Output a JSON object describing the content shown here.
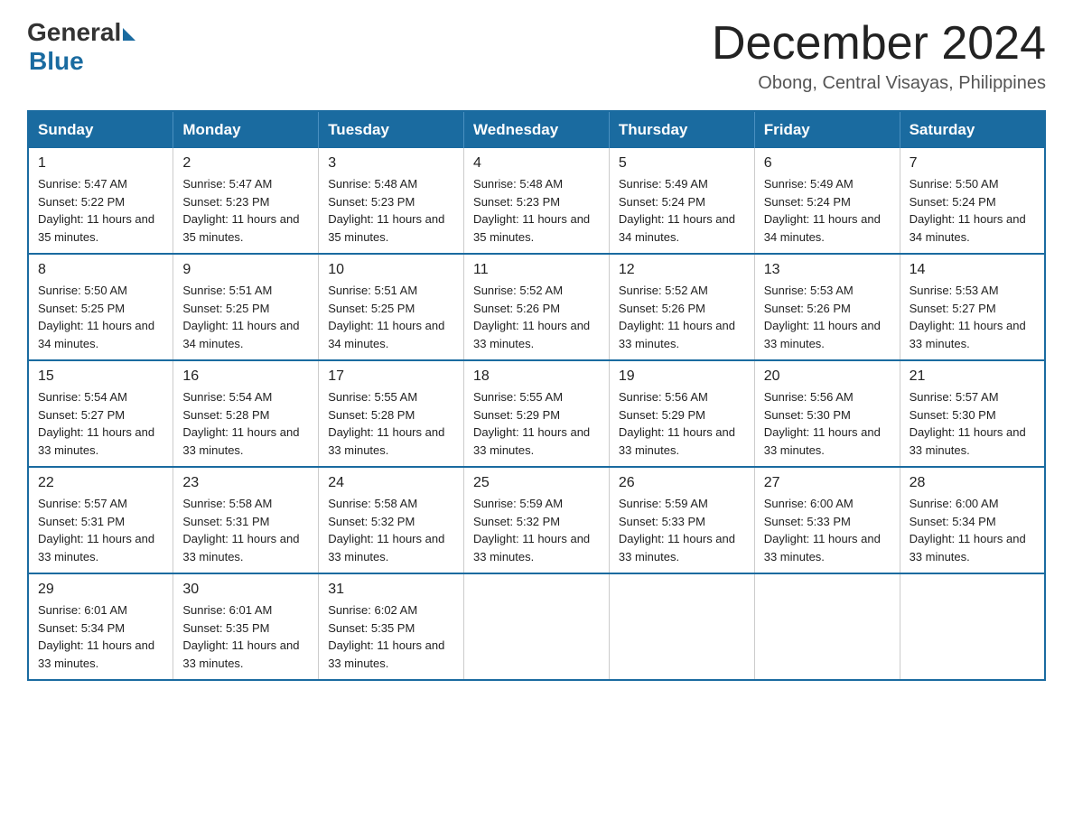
{
  "header": {
    "logo": {
      "general_text": "General",
      "blue_text": "Blue"
    },
    "title": "December 2024",
    "location": "Obong, Central Visayas, Philippines"
  },
  "days_of_week": [
    "Sunday",
    "Monday",
    "Tuesday",
    "Wednesday",
    "Thursday",
    "Friday",
    "Saturday"
  ],
  "weeks": [
    [
      {
        "day": "1",
        "sunrise": "5:47 AM",
        "sunset": "5:22 PM",
        "daylight": "11 hours and 35 minutes."
      },
      {
        "day": "2",
        "sunrise": "5:47 AM",
        "sunset": "5:23 PM",
        "daylight": "11 hours and 35 minutes."
      },
      {
        "day": "3",
        "sunrise": "5:48 AM",
        "sunset": "5:23 PM",
        "daylight": "11 hours and 35 minutes."
      },
      {
        "day": "4",
        "sunrise": "5:48 AM",
        "sunset": "5:23 PM",
        "daylight": "11 hours and 35 minutes."
      },
      {
        "day": "5",
        "sunrise": "5:49 AM",
        "sunset": "5:24 PM",
        "daylight": "11 hours and 34 minutes."
      },
      {
        "day": "6",
        "sunrise": "5:49 AM",
        "sunset": "5:24 PM",
        "daylight": "11 hours and 34 minutes."
      },
      {
        "day": "7",
        "sunrise": "5:50 AM",
        "sunset": "5:24 PM",
        "daylight": "11 hours and 34 minutes."
      }
    ],
    [
      {
        "day": "8",
        "sunrise": "5:50 AM",
        "sunset": "5:25 PM",
        "daylight": "11 hours and 34 minutes."
      },
      {
        "day": "9",
        "sunrise": "5:51 AM",
        "sunset": "5:25 PM",
        "daylight": "11 hours and 34 minutes."
      },
      {
        "day": "10",
        "sunrise": "5:51 AM",
        "sunset": "5:25 PM",
        "daylight": "11 hours and 34 minutes."
      },
      {
        "day": "11",
        "sunrise": "5:52 AM",
        "sunset": "5:26 PM",
        "daylight": "11 hours and 33 minutes."
      },
      {
        "day": "12",
        "sunrise": "5:52 AM",
        "sunset": "5:26 PM",
        "daylight": "11 hours and 33 minutes."
      },
      {
        "day": "13",
        "sunrise": "5:53 AM",
        "sunset": "5:26 PM",
        "daylight": "11 hours and 33 minutes."
      },
      {
        "day": "14",
        "sunrise": "5:53 AM",
        "sunset": "5:27 PM",
        "daylight": "11 hours and 33 minutes."
      }
    ],
    [
      {
        "day": "15",
        "sunrise": "5:54 AM",
        "sunset": "5:27 PM",
        "daylight": "11 hours and 33 minutes."
      },
      {
        "day": "16",
        "sunrise": "5:54 AM",
        "sunset": "5:28 PM",
        "daylight": "11 hours and 33 minutes."
      },
      {
        "day": "17",
        "sunrise": "5:55 AM",
        "sunset": "5:28 PM",
        "daylight": "11 hours and 33 minutes."
      },
      {
        "day": "18",
        "sunrise": "5:55 AM",
        "sunset": "5:29 PM",
        "daylight": "11 hours and 33 minutes."
      },
      {
        "day": "19",
        "sunrise": "5:56 AM",
        "sunset": "5:29 PM",
        "daylight": "11 hours and 33 minutes."
      },
      {
        "day": "20",
        "sunrise": "5:56 AM",
        "sunset": "5:30 PM",
        "daylight": "11 hours and 33 minutes."
      },
      {
        "day": "21",
        "sunrise": "5:57 AM",
        "sunset": "5:30 PM",
        "daylight": "11 hours and 33 minutes."
      }
    ],
    [
      {
        "day": "22",
        "sunrise": "5:57 AM",
        "sunset": "5:31 PM",
        "daylight": "11 hours and 33 minutes."
      },
      {
        "day": "23",
        "sunrise": "5:58 AM",
        "sunset": "5:31 PM",
        "daylight": "11 hours and 33 minutes."
      },
      {
        "day": "24",
        "sunrise": "5:58 AM",
        "sunset": "5:32 PM",
        "daylight": "11 hours and 33 minutes."
      },
      {
        "day": "25",
        "sunrise": "5:59 AM",
        "sunset": "5:32 PM",
        "daylight": "11 hours and 33 minutes."
      },
      {
        "day": "26",
        "sunrise": "5:59 AM",
        "sunset": "5:33 PM",
        "daylight": "11 hours and 33 minutes."
      },
      {
        "day": "27",
        "sunrise": "6:00 AM",
        "sunset": "5:33 PM",
        "daylight": "11 hours and 33 minutes."
      },
      {
        "day": "28",
        "sunrise": "6:00 AM",
        "sunset": "5:34 PM",
        "daylight": "11 hours and 33 minutes."
      }
    ],
    [
      {
        "day": "29",
        "sunrise": "6:01 AM",
        "sunset": "5:34 PM",
        "daylight": "11 hours and 33 minutes."
      },
      {
        "day": "30",
        "sunrise": "6:01 AM",
        "sunset": "5:35 PM",
        "daylight": "11 hours and 33 minutes."
      },
      {
        "day": "31",
        "sunrise": "6:02 AM",
        "sunset": "5:35 PM",
        "daylight": "11 hours and 33 minutes."
      },
      null,
      null,
      null,
      null
    ]
  ]
}
